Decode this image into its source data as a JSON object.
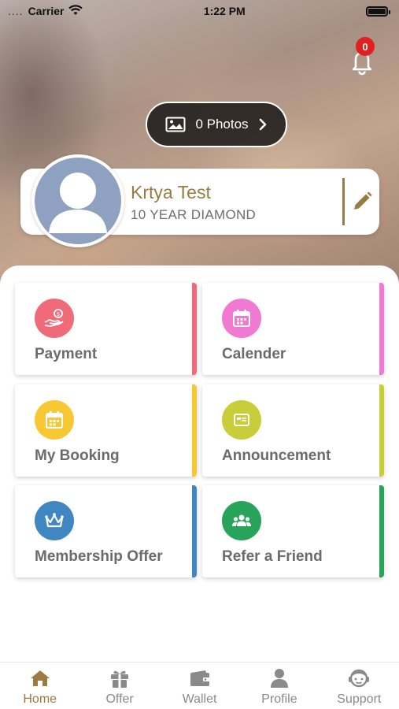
{
  "status_bar": {
    "carrier": "Carrier",
    "signal": "....",
    "time": "1:22 PM"
  },
  "notifications": {
    "count": "0"
  },
  "photos": {
    "label": "0 Photos"
  },
  "profile": {
    "name": "Krtya Test",
    "tier": "10 YEAR DIAMOND"
  },
  "menu": [
    {
      "label": "Payment",
      "color": "#f06b7a",
      "stripe": "#f06b7a",
      "icon": "money-hand-icon"
    },
    {
      "label": "Calender",
      "color": "#f07ad2",
      "stripe": "#f07ad2",
      "icon": "calendar-icon"
    },
    {
      "label": "My Booking",
      "color": "#f6c934",
      "stripe": "#f6c934",
      "icon": "booking-calendar-icon"
    },
    {
      "label": "Announcement",
      "color": "#c8cd3a",
      "stripe": "#c8cd3a",
      "icon": "announcement-icon"
    },
    {
      "label": "Membership Offer",
      "color": "#3f86c2",
      "stripe": "#3f86c2",
      "icon": "crown-icon"
    },
    {
      "label": "Refer a Friend",
      "color": "#27a35a",
      "stripe": "#27a35a",
      "icon": "people-icon"
    }
  ],
  "tabs": [
    {
      "label": "Home",
      "icon": "home-icon",
      "active": true
    },
    {
      "label": "Offer",
      "icon": "gift-icon",
      "active": false
    },
    {
      "label": "Wallet",
      "icon": "wallet-icon",
      "active": false
    },
    {
      "label": "Profile",
      "icon": "user-icon",
      "active": false
    },
    {
      "label": "Support",
      "icon": "support-agent-icon",
      "active": false
    }
  ],
  "colors": {
    "accent": "#9a7b40",
    "inactive_tab": "#8a8a8a",
    "badge": "#e02020"
  }
}
